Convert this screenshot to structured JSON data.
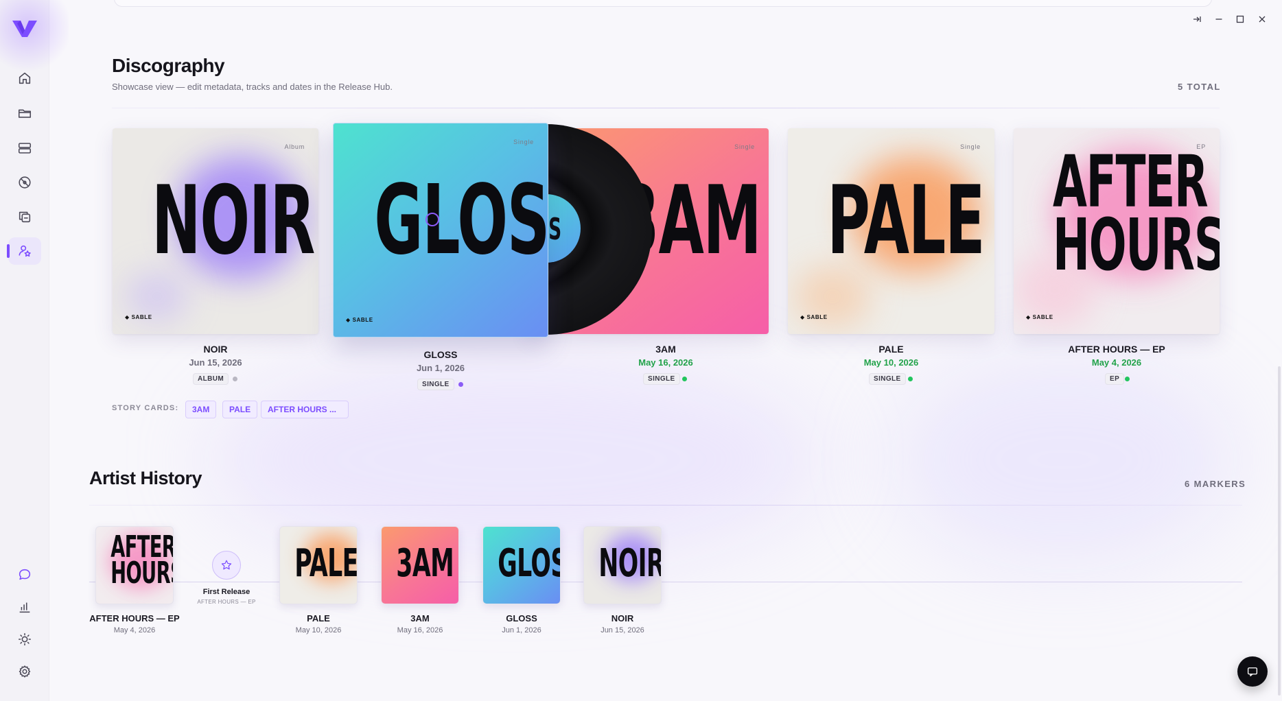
{
  "window": {
    "controls": [
      "collapse-icon",
      "minimize-icon",
      "maximize-icon",
      "close-icon"
    ]
  },
  "sidebar": {
    "logo": "V",
    "top_items": [
      {
        "icon": "home-icon",
        "active": false
      },
      {
        "icon": "folder-icon",
        "active": false
      },
      {
        "icon": "server-icon",
        "active": false
      },
      {
        "icon": "disc-icon",
        "active": false
      },
      {
        "icon": "copy-icon",
        "active": false
      },
      {
        "icon": "artist-star-icon",
        "active": true
      }
    ],
    "bottom_items": [
      {
        "icon": "chat-icon"
      },
      {
        "icon": "bar-chart-icon"
      },
      {
        "icon": "sun-icon"
      },
      {
        "icon": "settings-icon"
      }
    ]
  },
  "discography": {
    "title": "Discography",
    "subtitle": "Showcase view — edit metadata, tracks and dates in the Release Hub.",
    "count": "5 TOTAL",
    "releases": [
      {
        "cover_title": "NOIR",
        "cover_type": "Album",
        "brand": "SABLE",
        "name": "NOIR",
        "date": "Jun 15, 2026",
        "type": "ALBUM",
        "date_color": "gray",
        "dot": "#b9b7c2"
      },
      {
        "cover_title": "GLOSS",
        "cover_type": "Single",
        "brand": "SABLE",
        "name": "GLOSS",
        "date": "Jun 1, 2026",
        "type": "SINGLE",
        "date_color": "gray",
        "dot": "#8b5cf6"
      },
      {
        "cover_title": "3AM",
        "cover_type": "Single",
        "vinyl_label": "OSS",
        "name": "3AM",
        "date": "May 16, 2026",
        "type": "SINGLE",
        "date_color": "green",
        "dot": "#22c55e"
      },
      {
        "cover_title": "PALE",
        "cover_type": "Single",
        "brand": "SABLE",
        "name": "PALE",
        "date": "May 10, 2026",
        "type": "SINGLE",
        "date_color": "green",
        "dot": "#22c55e"
      },
      {
        "cover_title_line1": "AFTER",
        "cover_title_line2": "HOURS",
        "cover_type": "EP",
        "brand": "SABLE",
        "name": "AFTER HOURS — EP",
        "date": "May 4, 2026",
        "type": "EP",
        "date_color": "green",
        "dot": "#22c55e"
      }
    ],
    "story_cards_label": "STORY CARDS:",
    "story_cards": [
      "3AM",
      "PALE",
      "AFTER HOURS ..."
    ]
  },
  "history": {
    "title": "Artist History",
    "count": "6 MARKERS",
    "milestone": {
      "title": "First Release",
      "subtitle": "AFTER HOURS — EP",
      "icon": "star-icon"
    },
    "items": [
      {
        "thumb_line1": "AFTER",
        "thumb_line2": "HOURS",
        "name": "AFTER HOURS — EP",
        "date": "May 4, 2026"
      },
      {
        "thumb": "PALE",
        "name": "PALE",
        "date": "May 10, 2026"
      },
      {
        "thumb": "3AM",
        "name": "3AM",
        "date": "May 16, 2026"
      },
      {
        "thumb": "GLOSS",
        "name": "GLOSS",
        "date": "Jun 1, 2026"
      },
      {
        "thumb": "NOIR",
        "name": "NOIR",
        "date": "Jun 15, 2026"
      }
    ]
  },
  "colors": {
    "accent": "#7c4dff",
    "green": "#22a24a"
  }
}
